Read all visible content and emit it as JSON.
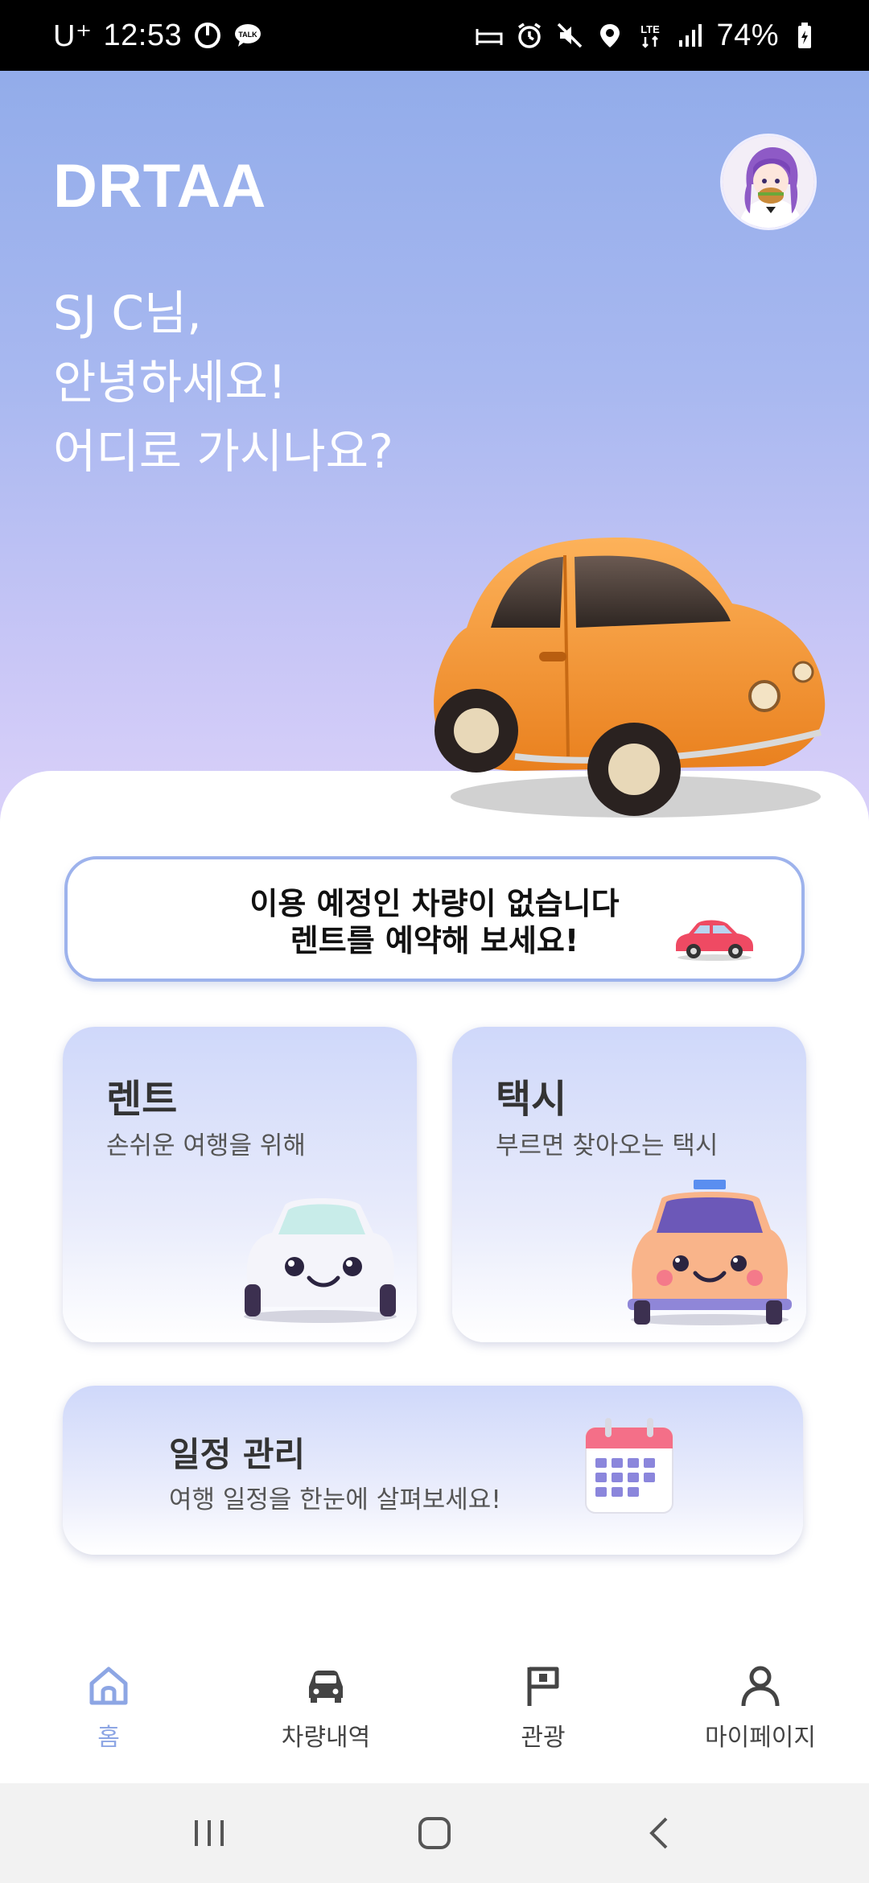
{
  "status_bar": {
    "carrier": "U⁺",
    "time": "12:53",
    "battery": "74%",
    "network": "LTE",
    "icons": [
      "timer-icon",
      "talk-icon",
      "sleep-icon",
      "alarm-icon",
      "mute-icon",
      "location-icon",
      "lte-icon",
      "signal-icon",
      "battery-icon"
    ]
  },
  "header": {
    "brand": "DRTAA",
    "avatar_icon": "profile-avatar"
  },
  "greeting": {
    "line1": "SJ C님,",
    "line2": "안녕하세요!",
    "line3": "어디로 가시나요?"
  },
  "notice": {
    "line1": "이용 예정인 차량이 없습니다",
    "line2": "렌트를 예약해 보세요!",
    "icon": "red-car-icon"
  },
  "services": {
    "rent": {
      "title": "렌트",
      "subtitle": "손쉬운 여행을 위해",
      "icon": "white-car-icon"
    },
    "taxi": {
      "title": "택시",
      "subtitle": "부르면 찾아오는 택시",
      "icon": "taxi-icon"
    },
    "schedule": {
      "title": "일정 관리",
      "subtitle": "여행 일정을 한눈에 살펴보세요!",
      "icon": "calendar-icon"
    }
  },
  "bottom_nav": [
    {
      "label": "홈",
      "icon": "home-icon",
      "active": true
    },
    {
      "label": "차량내역",
      "icon": "car-icon",
      "active": false
    },
    {
      "label": "관광",
      "icon": "flag-icon",
      "active": false
    },
    {
      "label": "마이페이지",
      "icon": "person-icon",
      "active": false
    }
  ],
  "colors": {
    "accent": "#8da6e4",
    "hero_top": "#92acea",
    "hero_bottom": "#dcd2fa",
    "card_top": "#cfd8fa",
    "car_orange": "#f59a3a"
  }
}
